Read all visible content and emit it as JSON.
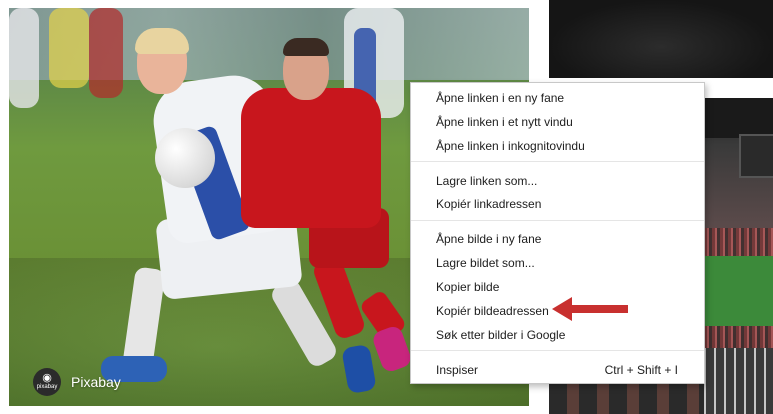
{
  "watermark": {
    "logo_caption": "pixabay",
    "name": "Pixabay"
  },
  "context_menu": {
    "items": [
      {
        "label": "Åpne linken i en ny fane"
      },
      {
        "label": "Åpne linken i et nytt vindu"
      },
      {
        "label": "Åpne linken i inkognitovindu"
      },
      {
        "label": "Lagre linken som..."
      },
      {
        "label": "Kopiér linkadressen"
      },
      {
        "label": "Åpne bilde i ny fane"
      },
      {
        "label": "Lagre bildet som..."
      },
      {
        "label": "Kopier bilde"
      },
      {
        "label": "Kopiér bildeadressen"
      },
      {
        "label": "Søk etter bilder i Google"
      },
      {
        "label": "Inspiser",
        "shortcut": "Ctrl + Shift + I"
      }
    ]
  },
  "colors": {
    "annotation_arrow": "#c8302f",
    "menu_border": "#c8c8c8"
  },
  "icons": {
    "watermark_logo": "camera-icon"
  }
}
